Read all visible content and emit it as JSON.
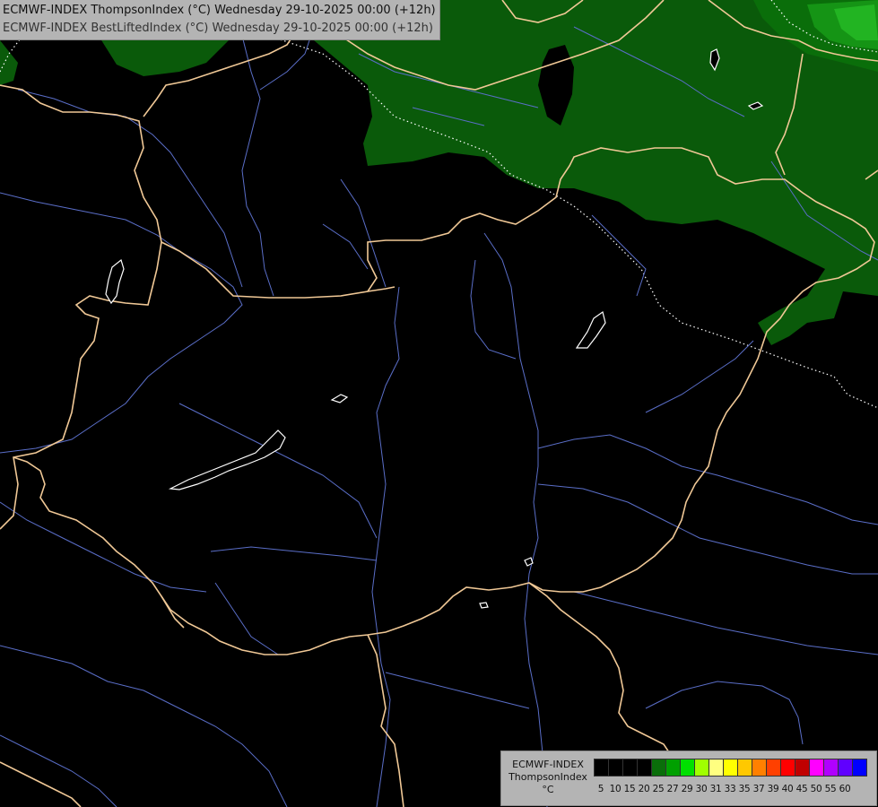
{
  "header": {
    "line1": "ECMWF-INDEX ThompsonIndex (°C) Wednesday 29-10-2025 00:00 (+12h)",
    "line2": "ECMWF-INDEX BestLiftedIndex (°C) Wednesday 29-10-2025 00:00 (+12h)"
  },
  "legend": {
    "source": "ECMWF-INDEX",
    "parameter": "ThompsonIndex",
    "unit": "°C",
    "ticks": [
      "5",
      "10",
      "15",
      "20",
      "25",
      "27",
      "29",
      "30",
      "31",
      "33",
      "35",
      "37",
      "39",
      "40",
      "45",
      "50",
      "55",
      "60"
    ],
    "colors": [
      "#000000",
      "#000000",
      "#000000",
      "#000000",
      "#0a6e0a",
      "#00a000",
      "#00e000",
      "#a0ff00",
      "#ffff80",
      "#ffff00",
      "#ffc800",
      "#ff8000",
      "#ff4000",
      "#ff0000",
      "#c00000",
      "#ff00ff",
      "#b000ff",
      "#6000ff",
      "#0000ff"
    ]
  },
  "map": {
    "background": "#000000",
    "fill_colors": {
      "low": "#0a5a0a",
      "mid": "#0a7a0a",
      "high": "#22b422"
    },
    "border_color": "#f0c896",
    "river_color": "#5a6ec8",
    "lake_color": "#ffffff",
    "coast_dotted_color": "#ffffff"
  }
}
